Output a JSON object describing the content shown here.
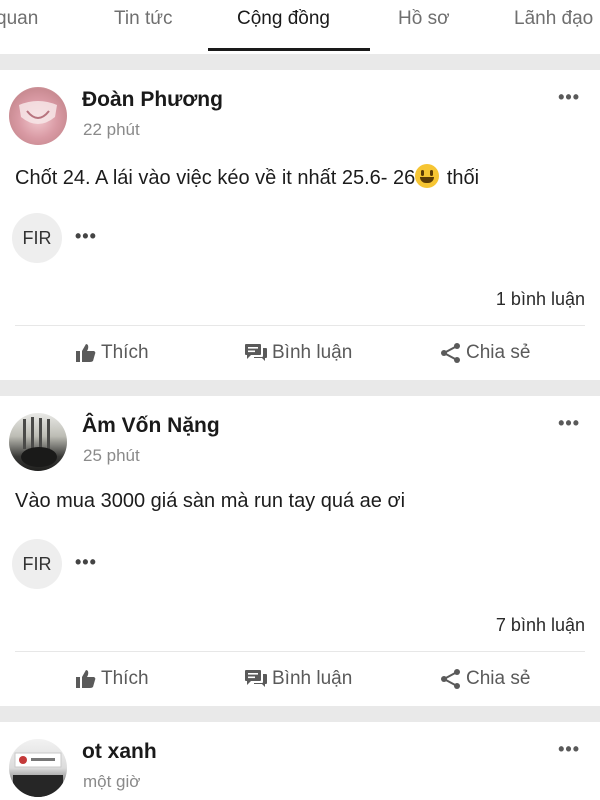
{
  "tabs": [
    {
      "label": "quan"
    },
    {
      "label": "Tin tức"
    },
    {
      "label": "Cộng đồng"
    },
    {
      "label": "Hồ sơ"
    },
    {
      "label": "Lãnh đạo"
    }
  ],
  "actions": {
    "like": "Thích",
    "comment": "Bình luận",
    "share": "Chia sẻ"
  },
  "posts": [
    {
      "author": "Đoàn Phương",
      "time": "22 phút",
      "content_before": "Chốt  24. A lái vào việc kéo về it nhất 25.6- 26",
      "content_after": " thối",
      "tag": "FIR",
      "comments": "1 bình luận"
    },
    {
      "author": "Âm Vốn Nặng",
      "time": "25 phút",
      "content": "Vào mua 3000 giá sàn mà run tay quá ae ơi",
      "tag": "FIR",
      "comments": "7 bình luận"
    },
    {
      "author": "ot xanh",
      "time": "một giờ"
    }
  ],
  "colors": {
    "divider": "#e9e9e9",
    "tag_bg": "#eeeeee",
    "text_secondary": "#8a8a8a"
  }
}
